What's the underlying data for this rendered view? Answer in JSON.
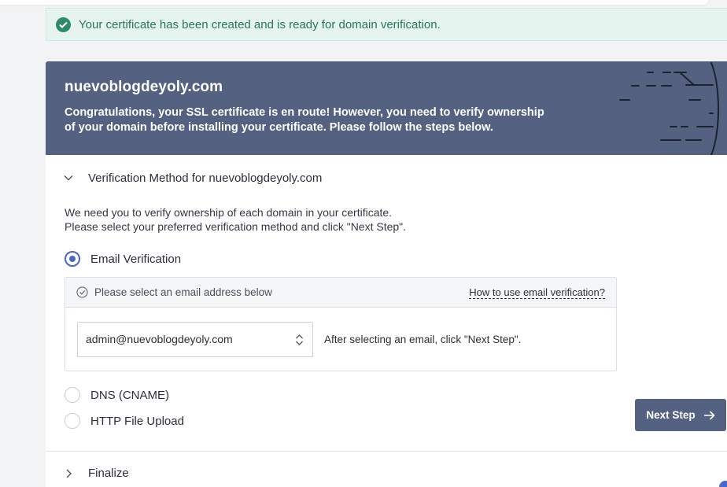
{
  "alert": {
    "message": "Your certificate has been created and is ready for domain verification."
  },
  "banner": {
    "domain": "nuevoblogdeyoly.com",
    "text": "Congratulations, your SSL certificate is en route! However, you need to verify ownership of your domain before installing your certificate. Please follow the steps below."
  },
  "verification": {
    "section_title": "Verification Method for nuevoblogdeyoly.com",
    "intro_line1": "We need you to verify ownership of each domain in your certificate.",
    "intro_line2": "Please select your preferred verification method and click \"Next Step\".",
    "options": [
      {
        "label": "Email Verification",
        "selected": true
      },
      {
        "label": "DNS (CNAME)",
        "selected": false
      },
      {
        "label": "HTTP File Upload",
        "selected": false
      }
    ],
    "email_box": {
      "hint": "Please select an email address below",
      "help_link": "How to use email verification?",
      "selected_email": "admin@nuevoblogdeyoly.com",
      "after_text": "After selecting an email, click \"Next Step\"."
    },
    "next_button": "Next Step"
  },
  "finalize": {
    "title": "Finalize"
  },
  "colors": {
    "banner": "#556181",
    "accent": "#4a67c8",
    "success": "#2f8a6b",
    "success_bg": "#e5f4ef"
  }
}
